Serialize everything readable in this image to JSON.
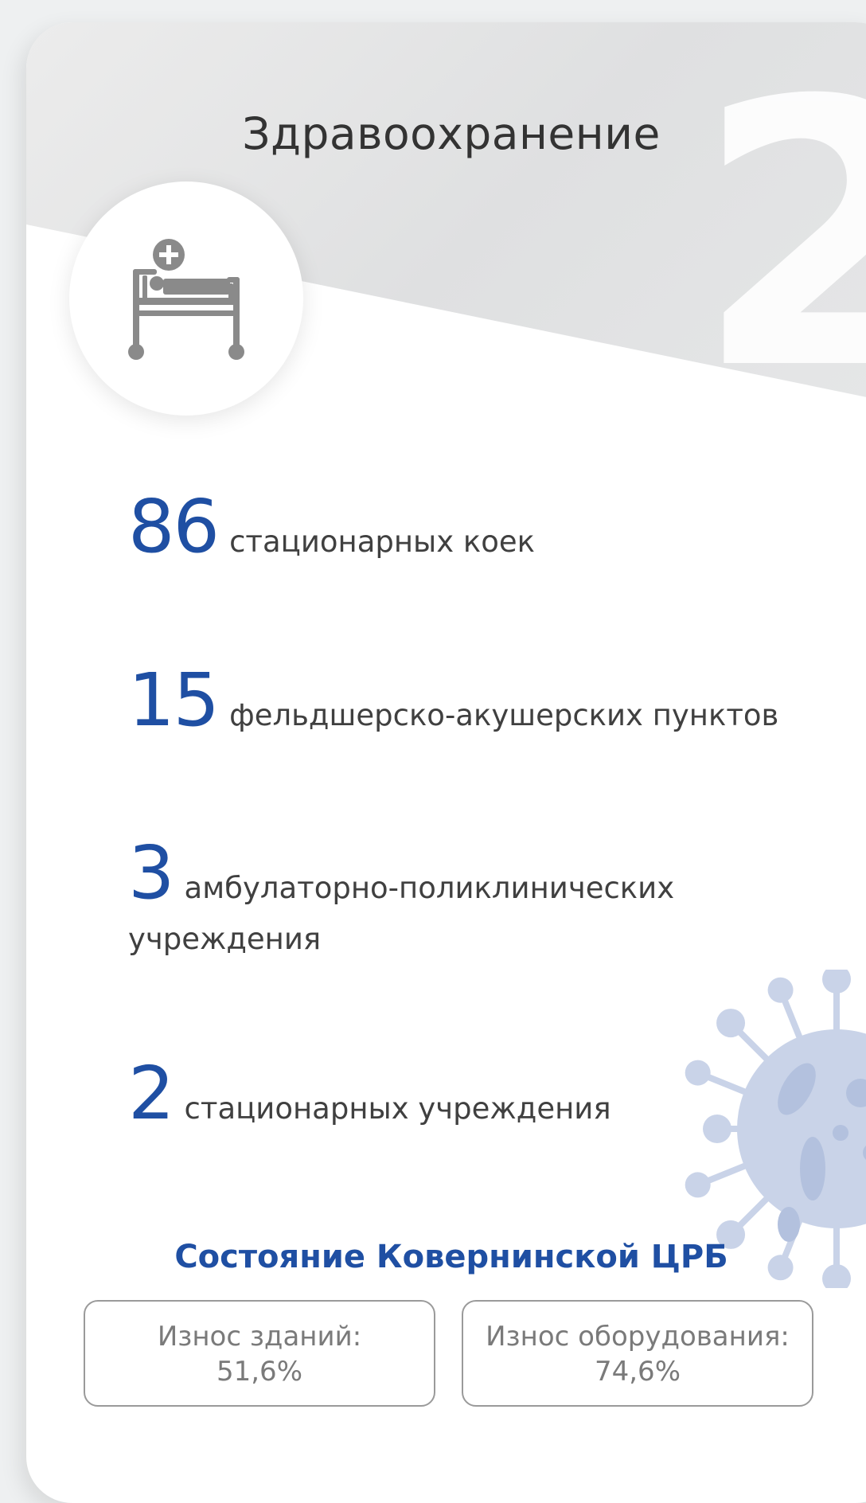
{
  "card": {
    "title": "Здравоохранение",
    "decor_digit": "2",
    "icon": "hospital-bed-icon"
  },
  "stats": [
    {
      "value": "86",
      "label": "стационарных коек"
    },
    {
      "value": "15",
      "label": "фельдшерско-акушерских пунктов"
    },
    {
      "value": "3",
      "label": "амбулаторно-поликлинических учреждения"
    },
    {
      "value": "2",
      "label": "стационарных учреждения"
    }
  ],
  "crb": {
    "title": "Состояние Ковернинской ЦРБ",
    "buildings_label": "Износ зданий:",
    "buildings_value": "51,6%",
    "equipment_label": "Износ оборудования:",
    "equipment_value": "74,6%"
  },
  "colors": {
    "accent": "#1f4fa3",
    "virus": "#c9d3e8",
    "icon_gray": "#8a8a8a"
  },
  "decor": {
    "virus_icon": "virus-icon"
  }
}
